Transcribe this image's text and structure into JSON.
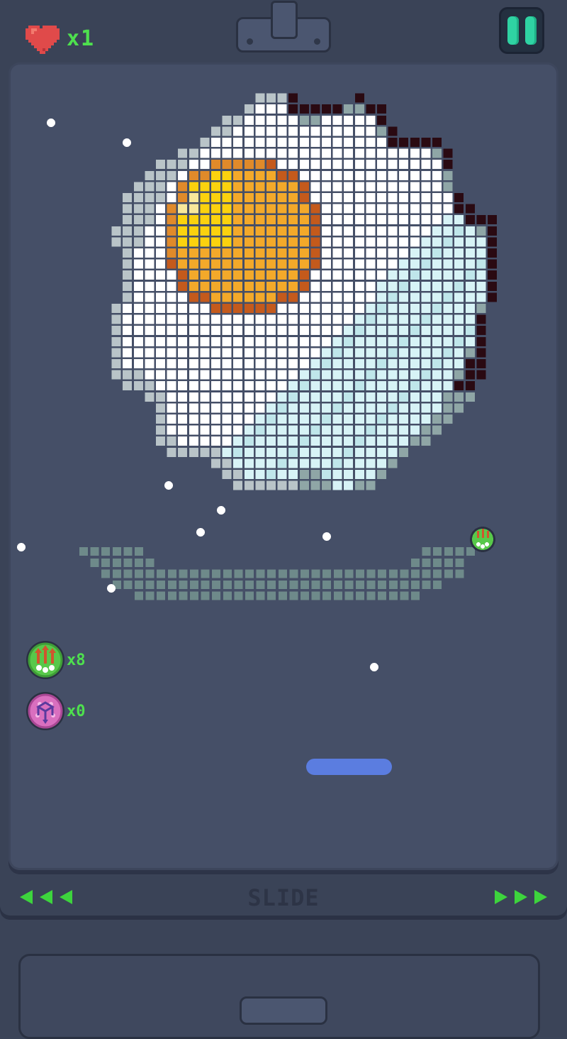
{
  "hud": {
    "lives_icon": "heart-icon",
    "lives_count": "x1",
    "pause_icon": "pause-icon"
  },
  "powerups": [
    {
      "icon": "multi-ball-arrows-icon",
      "count": "x8",
      "color": "#58c84a"
    },
    {
      "icon": "cube-expand-icon",
      "count": "x0",
      "color": "#d96fbf"
    }
  ],
  "controls": {
    "left_icon": "triple-left-arrow-icon",
    "label": "SLIDE",
    "right_icon": "triple-right-arrow-icon"
  },
  "colors": {
    "background": "#3b4458",
    "playfield": "#454f67",
    "accent_green": "#4ee04e",
    "paddle": "#5b7de0",
    "pause": "#2fd3a3",
    "heart": "#e04a4a"
  },
  "artwork": "fried-egg-pixel-art"
}
